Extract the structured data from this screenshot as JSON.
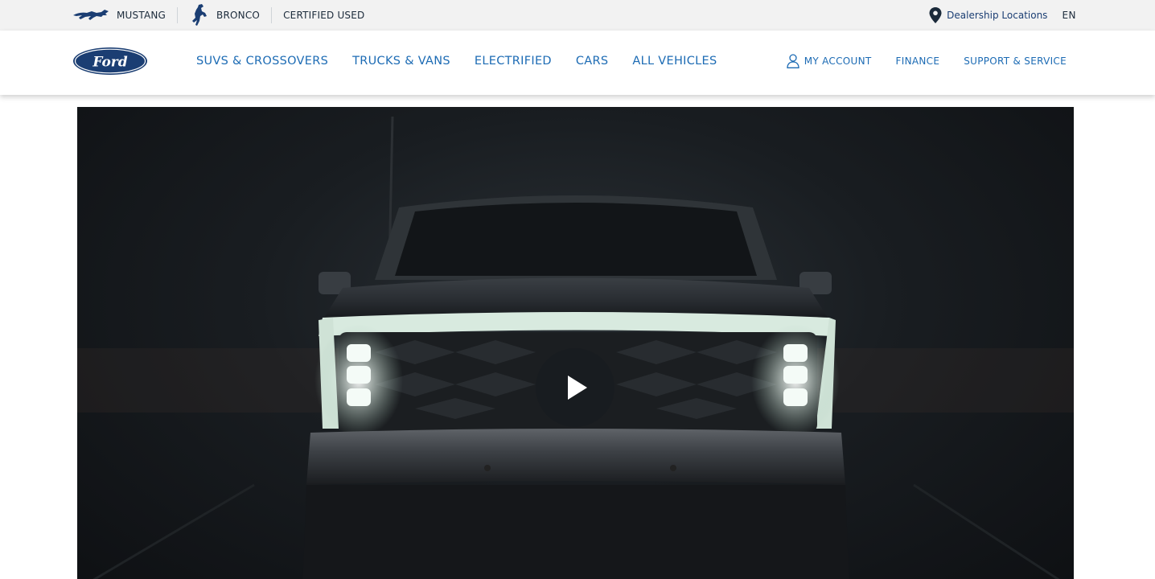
{
  "utility_bar": {
    "brands": [
      {
        "label": "MUSTANG",
        "icon": "mustang-logo-icon"
      },
      {
        "label": "BRONCO",
        "icon": "bronco-logo-icon"
      },
      {
        "label": "CERTIFIED USED"
      }
    ],
    "dealer_locations": "Dealership Locations",
    "language": "EN"
  },
  "main_nav": {
    "logo_text": "Ford",
    "links": [
      "SUVS & CROSSOVERS",
      "TRUCKS & VANS",
      "ELECTRIFIED",
      "CARS",
      "ALL VEHICLES"
    ],
    "account": "MY ACCOUNT",
    "finance": "FINANCE",
    "support": "SUPPORT & SERVICE"
  },
  "hero": {
    "media": "video",
    "play_icon": "play-icon"
  },
  "colors": {
    "nav_link": "#1c6bb4",
    "utility_bg": "#f2f2f2",
    "ford_blue": "#1b3e73"
  }
}
